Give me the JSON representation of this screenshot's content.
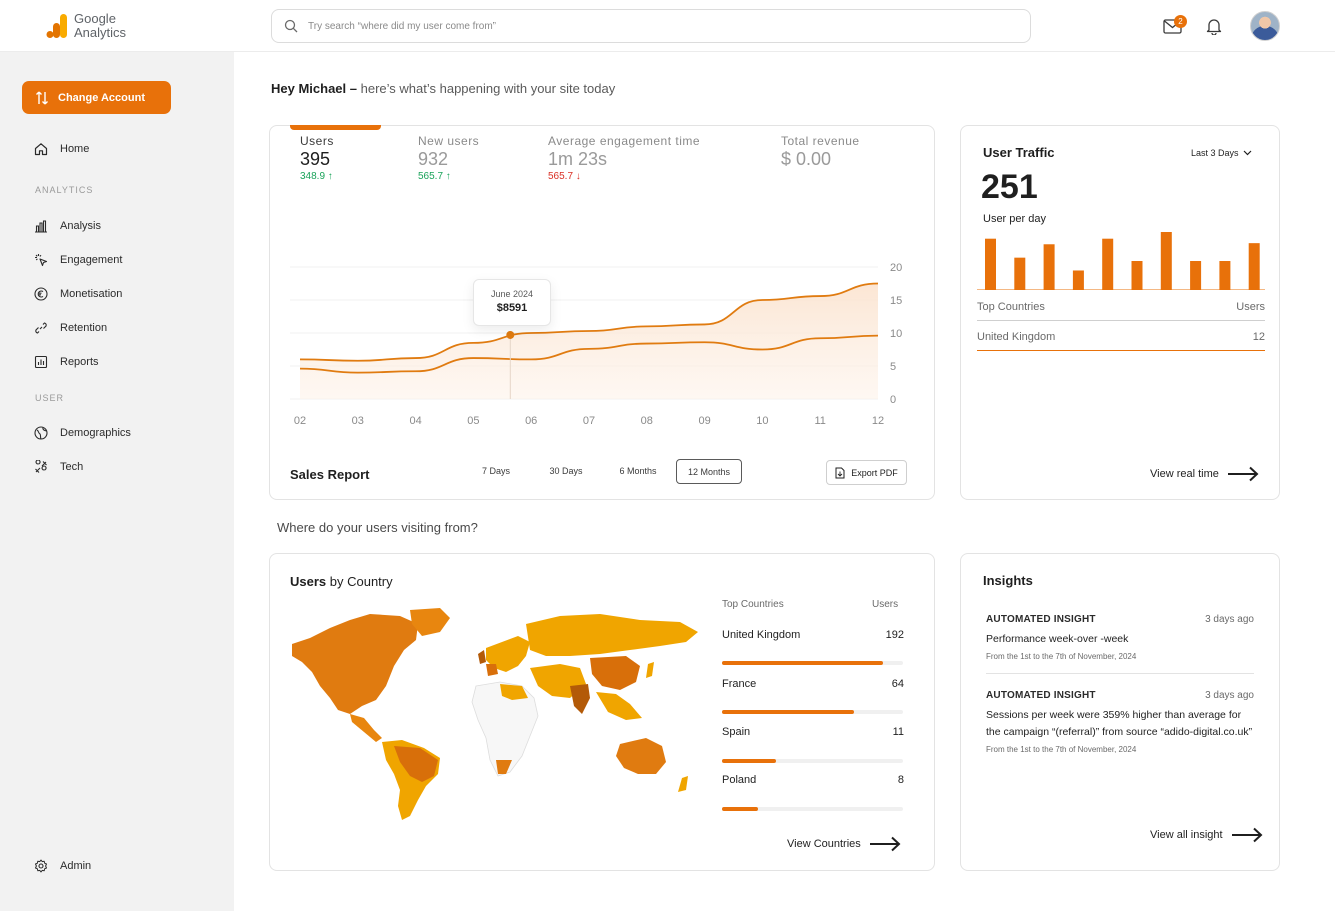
{
  "logo": {
    "line1": "Google",
    "line2": "Analytics"
  },
  "search": {
    "placeholder": "Try search “where did my user come from”"
  },
  "header": {
    "notification_count": "2"
  },
  "sidebar": {
    "change_account": "Change Account",
    "home": "Home",
    "section_analytics": "ANALYTICS",
    "analysis": "Analysis",
    "engagement": "Engagement",
    "monetisation": "Monetisation",
    "retention": "Retention",
    "reports": "Reports",
    "section_user": "USER",
    "demographics": "Demographics",
    "tech": "Tech",
    "admin": "Admin"
  },
  "greeting": {
    "name": "Hey Michael –",
    "rest": " here’s what’s happening with your site today"
  },
  "metrics": [
    {
      "label": "Users",
      "value": "395",
      "change": "348.9 ↑",
      "trend": "up"
    },
    {
      "label": "New users",
      "value": "932",
      "change": "565.7 ↑",
      "trend": "up"
    },
    {
      "label": "Average engagement time",
      "value": "1m 23s",
      "change": "565.7 ↓",
      "trend": "down"
    },
    {
      "label": "Total revenue",
      "value": "$ 0.00",
      "change": "",
      "trend": ""
    }
  ],
  "chart_data": {
    "type": "area",
    "x": [
      "02",
      "03",
      "04",
      "05",
      "06",
      "07",
      "08",
      "09",
      "10",
      "11",
      "12"
    ],
    "yticks": [
      "20",
      "15",
      "10",
      "5",
      "0"
    ],
    "ylim": [
      0,
      20
    ],
    "series": [
      {
        "values": [
          6.0,
          5.8,
          6.2,
          8.5,
          10.0,
          10.3,
          11.0,
          11.3,
          15.0,
          15.6,
          17.5
        ]
      },
      {
        "values": [
          4.6,
          4.0,
          4.2,
          6.2,
          6.0,
          7.6,
          8.4,
          8.6,
          7.5,
          9.2,
          9.6
        ]
      }
    ],
    "tooltip": {
      "label": "June 2024",
      "value": "$8591"
    },
    "grid": true
  },
  "sales": {
    "title": "Sales Report",
    "ranges": [
      "7 Days",
      "30 Days",
      "6 Months",
      "12 Months"
    ],
    "selected_range": "12 Months",
    "export": "Export PDF"
  },
  "traffic": {
    "title": "User Traffic",
    "range": "Last 3 Days",
    "value": "251",
    "subtitle": "User per day",
    "bars": [
      92,
      58,
      82,
      35,
      92,
      52,
      104,
      52,
      52,
      84
    ],
    "col_country": "Top Countries",
    "col_users": "Users",
    "row_country": "United Kingdom",
    "row_users": "12",
    "link": "View real time"
  },
  "visit_question": "Where do your  users visiting from?",
  "country": {
    "title_bold": "Users",
    "title_rest": "  by Country",
    "col_country": "Top Countries",
    "col_users": "Users",
    "rows": [
      {
        "name": "United Kingdom",
        "users": "192",
        "share": 0.89
      },
      {
        "name": "France",
        "users": "64",
        "share": 0.73
      },
      {
        "name": "Spain",
        "users": "11",
        "share": 0.3
      },
      {
        "name": "Poland",
        "users": "8",
        "share": 0.2
      }
    ],
    "link": "View Countries"
  },
  "insights": {
    "title": "Insights",
    "items": [
      {
        "kind": "AUTOMATED INSIGHT",
        "ago": "3 days ago",
        "text": "Performance week-over -week",
        "meta": "From the 1st to the 7th of November, 2024"
      },
      {
        "kind": "AUTOMATED INSIGHT",
        "ago": "3 days ago",
        "text": "Sessions per week were 359% higher than average for the campaign “(referral)” from source “adido-digital.co.uk”",
        "meta": "From the 1st to the 7th of November, 2024"
      }
    ],
    "link": "View all insight"
  },
  "colors": {
    "accent": "#e8710a",
    "accent_light": "#fbe9dc",
    "up": "#1aa35a",
    "down": "#d93025"
  }
}
